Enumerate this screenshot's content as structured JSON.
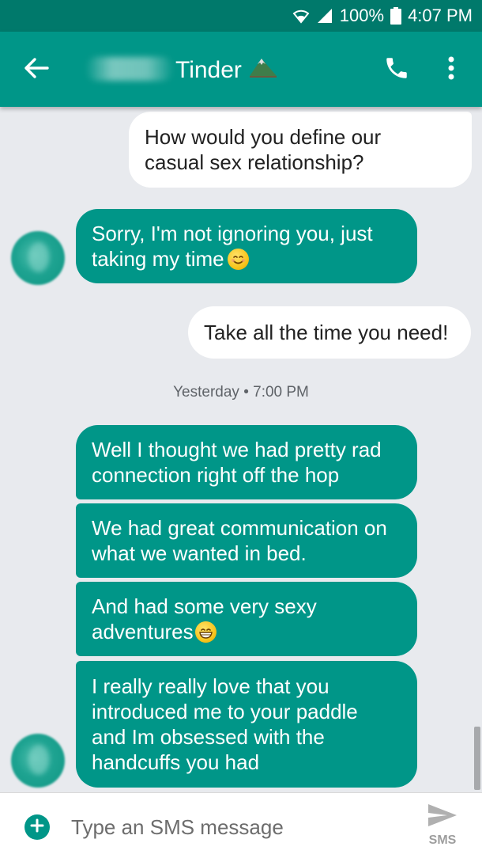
{
  "status_bar": {
    "battery": "100%",
    "time": "4:07 PM"
  },
  "header": {
    "contact_name": "Tinder"
  },
  "messages": [
    {
      "direction": "out",
      "text": "How would you define our\ncasual sex relationship?"
    },
    {
      "direction": "in",
      "text": "Sorry, I'm not ignoring you, just\ntaking my time",
      "emoji": "smiling-face-emoji"
    },
    {
      "direction": "out",
      "text": "Take all the time you need!"
    },
    {
      "direction": "in",
      "text": "Well I thought we had pretty rad\nconnection right off the hop"
    },
    {
      "direction": "in",
      "text": "We had great communication on\nwhat we wanted in bed."
    },
    {
      "direction": "in",
      "text": "And had some very sexy\nadventures",
      "emoji": "grinning-face-emoji"
    },
    {
      "direction": "in",
      "text": "I really really love that you\nintroduced me to your paddle\nand Im obsessed with the\nhandcuffs you had"
    }
  ],
  "timestamp": "Yesterday • 7:00 PM",
  "compose": {
    "placeholder": "Type an SMS message",
    "send_label": "SMS"
  },
  "colors": {
    "primary": "#009688",
    "primary_dark": "#00796b",
    "background": "#e8eaee",
    "outgoing_bubble": "#ffffff"
  },
  "icons": [
    "wifi-icon",
    "signal-icon",
    "battery-icon",
    "back-arrow-icon",
    "mountain-emoji-icon",
    "phone-icon",
    "more-vert-icon",
    "add-icon",
    "send-icon"
  ]
}
